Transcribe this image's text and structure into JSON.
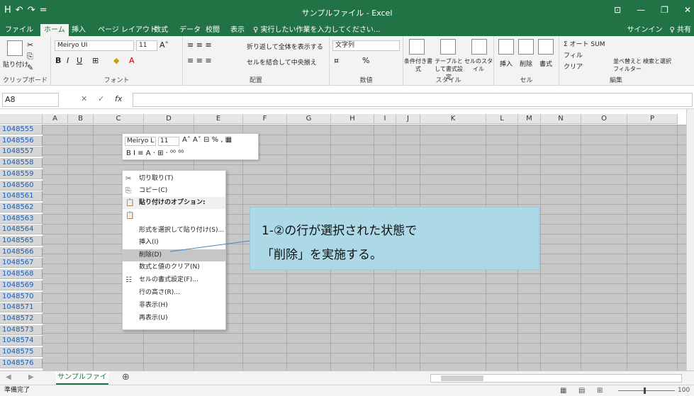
{
  "window": {
    "title": "サンプルファイル - Excel",
    "quick_access": [
      "H",
      "↶",
      "↷",
      "="
    ],
    "controls": [
      "⊡",
      "—",
      "❐",
      "✕"
    ]
  },
  "tabs": [
    "ファイル",
    "ホーム",
    "挿入",
    "ページ レイアウト",
    "数式",
    "データ",
    "校閲",
    "表示"
  ],
  "active_tab": "ホーム",
  "tell_me": "♀ 実行したい作業を入力してください...",
  "signin": "サインイン",
  "share": "♀ 共有",
  "ribbon": {
    "clipboard": {
      "label": "クリップボード",
      "paste": "貼り付け"
    },
    "font": {
      "label": "フォント",
      "name": "Meiryo UI",
      "size": "11",
      "bold": "B",
      "italic": "I",
      "underline": "U"
    },
    "alignment": {
      "label": "配置",
      "wrap": "折り返して全体を表示する",
      "merge": "セルを結合して中央揃え"
    },
    "number": {
      "label": "数値",
      "format": "文字列",
      "percent": "%"
    },
    "styles": {
      "label": "スタイル",
      "cond": "条件付き書式",
      "table": "テーブルとして書式設定",
      "cell": "セルのスタイル"
    },
    "cells": {
      "label": "セル",
      "insert": "挿入",
      "delete": "削除",
      "format": "書式"
    },
    "editing": {
      "label": "編集",
      "autosum": "Σ オート SUM",
      "fill": "フィル",
      "clear": "クリア",
      "sort": "並べ替えとフィルター",
      "find": "検索と選択"
    }
  },
  "formula_bar": {
    "name_box": "A8",
    "cancel": "✕",
    "enter": "✓",
    "fx": "fx",
    "value": ""
  },
  "columns": [
    "A",
    "B",
    "C",
    "D",
    "E",
    "F",
    "G",
    "H",
    "I",
    "J",
    "K",
    "L",
    "M",
    "N",
    "O",
    "P"
  ],
  "rows": [
    "1048555",
    "1048556",
    "1048557",
    "1048558",
    "1048559",
    "1048560",
    "1048561",
    "1048562",
    "1048563",
    "1048564",
    "1048565",
    "1048566",
    "1048567",
    "1048568",
    "1048569",
    "1048570",
    "1048571",
    "1048572",
    "1048573",
    "1048574",
    "1048575",
    "1048576"
  ],
  "mini_toolbar": {
    "font": "Meiryo L",
    "size": "11",
    "line2": "B  I  ≡  A  ·  ⊞  ·  ⁰⁰  ⁰⁰"
  },
  "context_menu": [
    {
      "icon": "✂",
      "label": "切り取り(T)",
      "type": "item"
    },
    {
      "icon": "⎘",
      "label": "コピー(C)",
      "type": "item"
    },
    {
      "icon": "📋",
      "label": "貼り付けのオプション:",
      "type": "header"
    },
    {
      "icon": "📋",
      "label": "",
      "type": "item"
    },
    {
      "icon": "",
      "label": "形式を選択して貼り付け(S)...",
      "type": "item"
    },
    {
      "icon": "",
      "label": "挿入(I)",
      "type": "item"
    },
    {
      "icon": "",
      "label": "削除(D)",
      "type": "highlight"
    },
    {
      "icon": "",
      "label": "数式と値のクリア(N)",
      "type": "item"
    },
    {
      "icon": "☷",
      "label": "セルの書式設定(F)...",
      "type": "item"
    },
    {
      "icon": "",
      "label": "行の高さ(R)...",
      "type": "item"
    },
    {
      "icon": "",
      "label": "非表示(H)",
      "type": "item"
    },
    {
      "icon": "",
      "label": "再表示(U)",
      "type": "item"
    }
  ],
  "callout": {
    "line1": "1-②の行が選択された状態で",
    "line2": "「削除」を実施する。"
  },
  "sheet": {
    "tab": "サンプルファイル",
    "add": "⊕"
  },
  "status": {
    "text": "準備完了",
    "zoom": "100"
  }
}
